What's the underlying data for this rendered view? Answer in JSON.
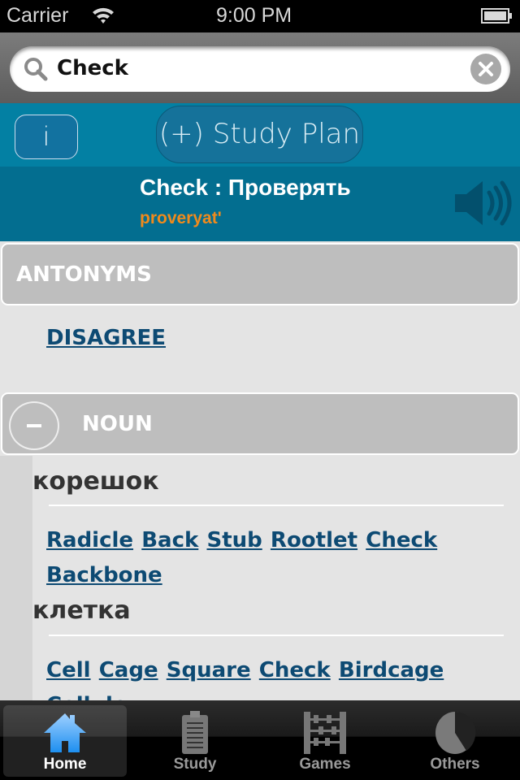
{
  "status_bar": {
    "carrier": "Carrier",
    "time": "9:00 PM"
  },
  "search": {
    "value": "Check",
    "placeholder": ""
  },
  "toolbar": {
    "info_label": "i",
    "study_plan_label": "(+) Study Plan"
  },
  "word": {
    "title": "Check : Проверять",
    "transliteration": "proveryat'"
  },
  "antonyms": {
    "header": "ANTONYMS",
    "items": [
      "DISAGREE"
    ]
  },
  "noun": {
    "header": "NOUN",
    "toggle": "−",
    "groups": [
      {
        "word": "корешок",
        "synonyms": [
          "Radicle",
          "Back",
          "Stub",
          "Rootlet",
          "Check",
          "Backbone"
        ]
      },
      {
        "word": "клетка",
        "synonyms": [
          "Cell",
          "Cage",
          "Square",
          "Check",
          "Birdcage",
          "Cellule"
        ]
      }
    ]
  },
  "tabs": [
    {
      "label": "Home",
      "icon": "home-icon",
      "selected": true
    },
    {
      "label": "Study",
      "icon": "clipboard-icon"
    },
    {
      "label": "Games",
      "icon": "abacus-icon"
    },
    {
      "label": "Others",
      "icon": "pie-icon"
    }
  ],
  "colors": {
    "accent": "#0380a3",
    "word_bar": "#036e90",
    "transliteration": "#f08a1c",
    "link": "#0d4a73"
  }
}
